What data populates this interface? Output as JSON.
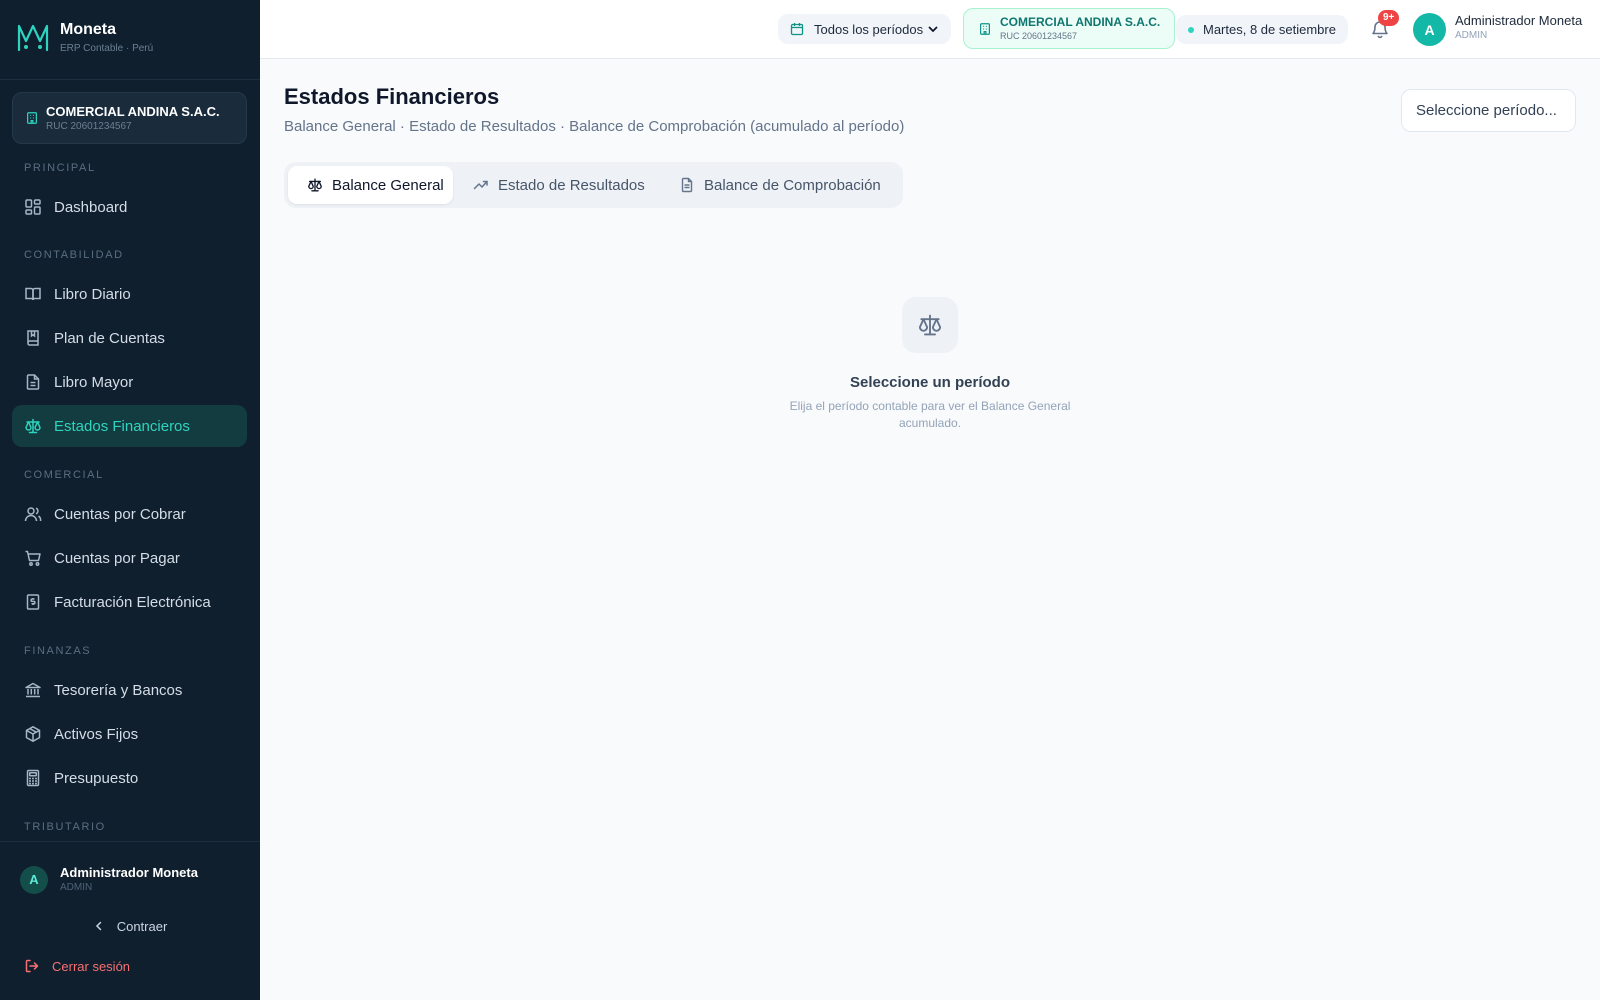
{
  "brand": {
    "name": "Moneta",
    "subtitle": "ERP Contable · Perú"
  },
  "company": {
    "name": "COMERCIAL ANDINA S.A.C.",
    "ruc": "RUC 20601234567"
  },
  "sidebar": {
    "sections": {
      "principal": "PRINCIPAL",
      "contabilidad": "CONTABILIDAD",
      "comercial": "COMERCIAL",
      "finanzas": "FINANZAS",
      "tributario": "TRIBUTARIO"
    },
    "items": {
      "dashboard": "Dashboard",
      "libro_diario": "Libro Diario",
      "plan_cuentas": "Plan de Cuentas",
      "libro_mayor": "Libro Mayor",
      "estados_financieros": "Estados Financieros",
      "cuentas_cobrar": "Cuentas por Cobrar",
      "cuentas_pagar": "Cuentas por Pagar",
      "facturacion": "Facturación Electrónica",
      "tesoreria": "Tesorería y Bancos",
      "activos_fijos": "Activos Fijos",
      "presupuesto": "Presupuesto"
    },
    "active_item": "Estados Financieros",
    "user": {
      "name": "Administrador Moneta",
      "role": "ADMIN",
      "initial": "A"
    },
    "collapse_label": "Contraer",
    "logout_label": "Cerrar sesión"
  },
  "topbar": {
    "period_filter": "Todos los períodos",
    "date": "Martes, 8 de setiembre",
    "notifications_badge": "9+",
    "user": {
      "name": "Administrador Moneta",
      "role": "ADMIN",
      "initial": "A"
    }
  },
  "main": {
    "title": "Estados Financieros",
    "subtitle": "Balance General · Estado de Resultados · Balance de Comprobación (acumulado al período)",
    "period_select_placeholder": "Seleccione período...",
    "tabs": [
      {
        "label": "Balance General",
        "icon": "scale-icon",
        "active": true
      },
      {
        "label": "Estado de Resultados",
        "icon": "trending-up-icon",
        "active": false
      },
      {
        "label": "Balance de Comprobación",
        "icon": "document-icon",
        "active": false
      }
    ],
    "empty_state": {
      "icon": "scale-icon",
      "title": "Seleccione un período",
      "description": "Elija el período contable para ver el Balance General acumulado."
    }
  },
  "colors": {
    "sidebar_bg": "#0f1f2e",
    "accent": "#2dd4bf",
    "active_bg": "#123c40",
    "logout": "#f87171",
    "badge": "#ef4444"
  }
}
